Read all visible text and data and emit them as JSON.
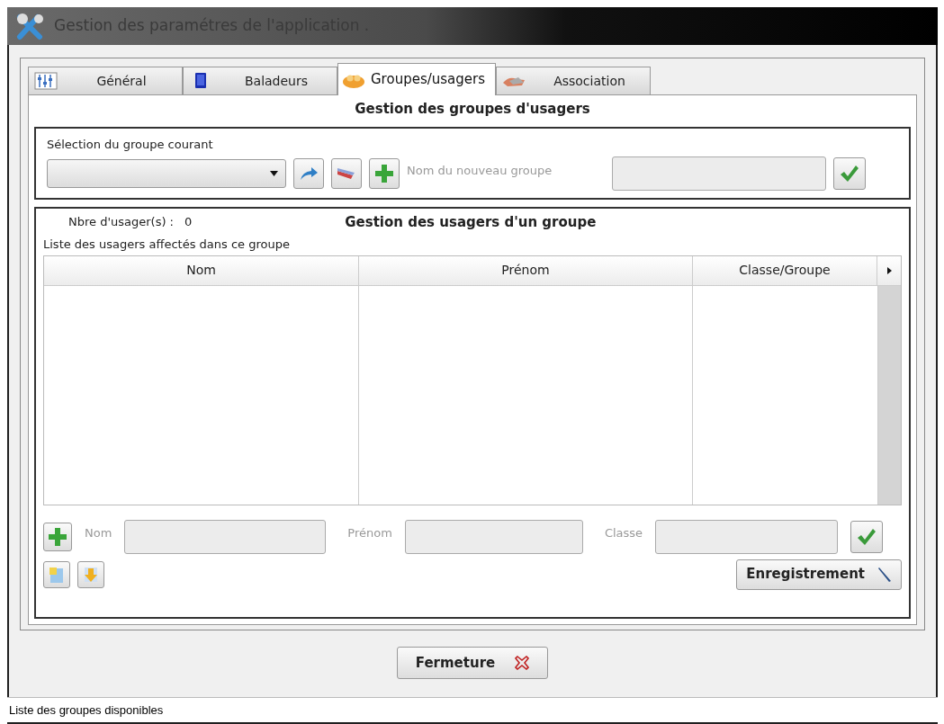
{
  "window": {
    "title": "Gestion des paramétres de l'application ."
  },
  "tabs": [
    {
      "label": "Général",
      "selected": false
    },
    {
      "label": "Baladeurs",
      "selected": false
    },
    {
      "label": "Groupes/usagers",
      "selected": true
    },
    {
      "label": "Association",
      "selected": false
    }
  ],
  "groups": {
    "title": "Gestion des groupes d'usagers",
    "select_label": "Sélection du groupe courant",
    "new_group_label": "Nom du nouveau groupe"
  },
  "users": {
    "count_label": "Nbre d'usager(s) :",
    "count": "0",
    "title": "Gestion des usagers d'un groupe",
    "list_label": "Liste des usagers affectés dans ce groupe",
    "columns": [
      "Nom",
      "Prénom",
      "Classe/Groupe"
    ],
    "fields": [
      {
        "label": "Nom"
      },
      {
        "label": "Prénom"
      },
      {
        "label": "Classe"
      }
    ],
    "save_button": "Enregistrement"
  },
  "close_button": "Fermeture",
  "status_bar": "Liste des groupes disponibles"
}
